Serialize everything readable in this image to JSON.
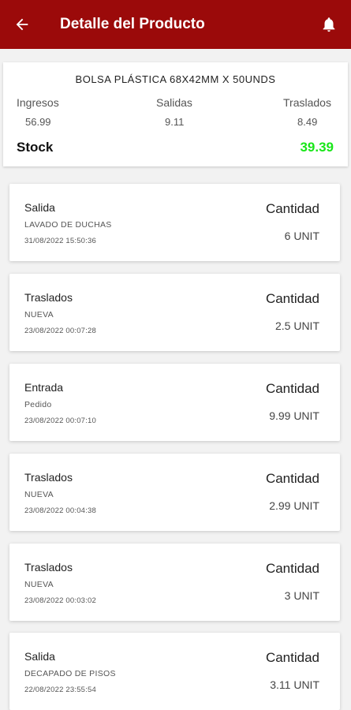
{
  "header": {
    "title": "Detalle del Producto",
    "back_icon": "arrow-left-icon",
    "bell_icon": "bell-icon",
    "bar_color": "#9b0a0a"
  },
  "summary": {
    "product_name": "BOLSA PLÁSTICA 68X42MM X 50UNDS",
    "ingresos_label": "Ingresos",
    "ingresos_value": "56.99",
    "salidas_label": "Salidas",
    "salidas_value": "9.11",
    "traslados_label": "Traslados",
    "traslados_value": "8.49",
    "stock_label": "Stock",
    "stock_value": "39.39",
    "stock_color": "#19e619"
  },
  "movements": [
    {
      "type": "Salida",
      "desc": "LAVADO DE DUCHAS",
      "date": "31/08/2022 15:50:36",
      "qty_label": "Cantidad",
      "qty": "6 UNIT"
    },
    {
      "type": "Traslados",
      "desc": "NUEVA",
      "date": "23/08/2022 00:07:28",
      "qty_label": "Cantidad",
      "qty": "2.5 UNIT"
    },
    {
      "type": "Entrada",
      "desc": "Pedido",
      "date": "23/08/2022 00:07:10",
      "qty_label": "Cantidad",
      "qty": "9.99 UNIT"
    },
    {
      "type": "Traslados",
      "desc": "NUEVA",
      "date": "23/08/2022 00:04:38",
      "qty_label": "Cantidad",
      "qty": "2.99 UNIT"
    },
    {
      "type": "Traslados",
      "desc": "NUEVA",
      "date": "23/08/2022 00:03:02",
      "qty_label": "Cantidad",
      "qty": "3 UNIT"
    },
    {
      "type": "Salida",
      "desc": "DECAPADO DE PISOS",
      "date": "22/08/2022 23:55:54",
      "qty_label": "Cantidad",
      "qty": "3.11 UNIT"
    }
  ]
}
